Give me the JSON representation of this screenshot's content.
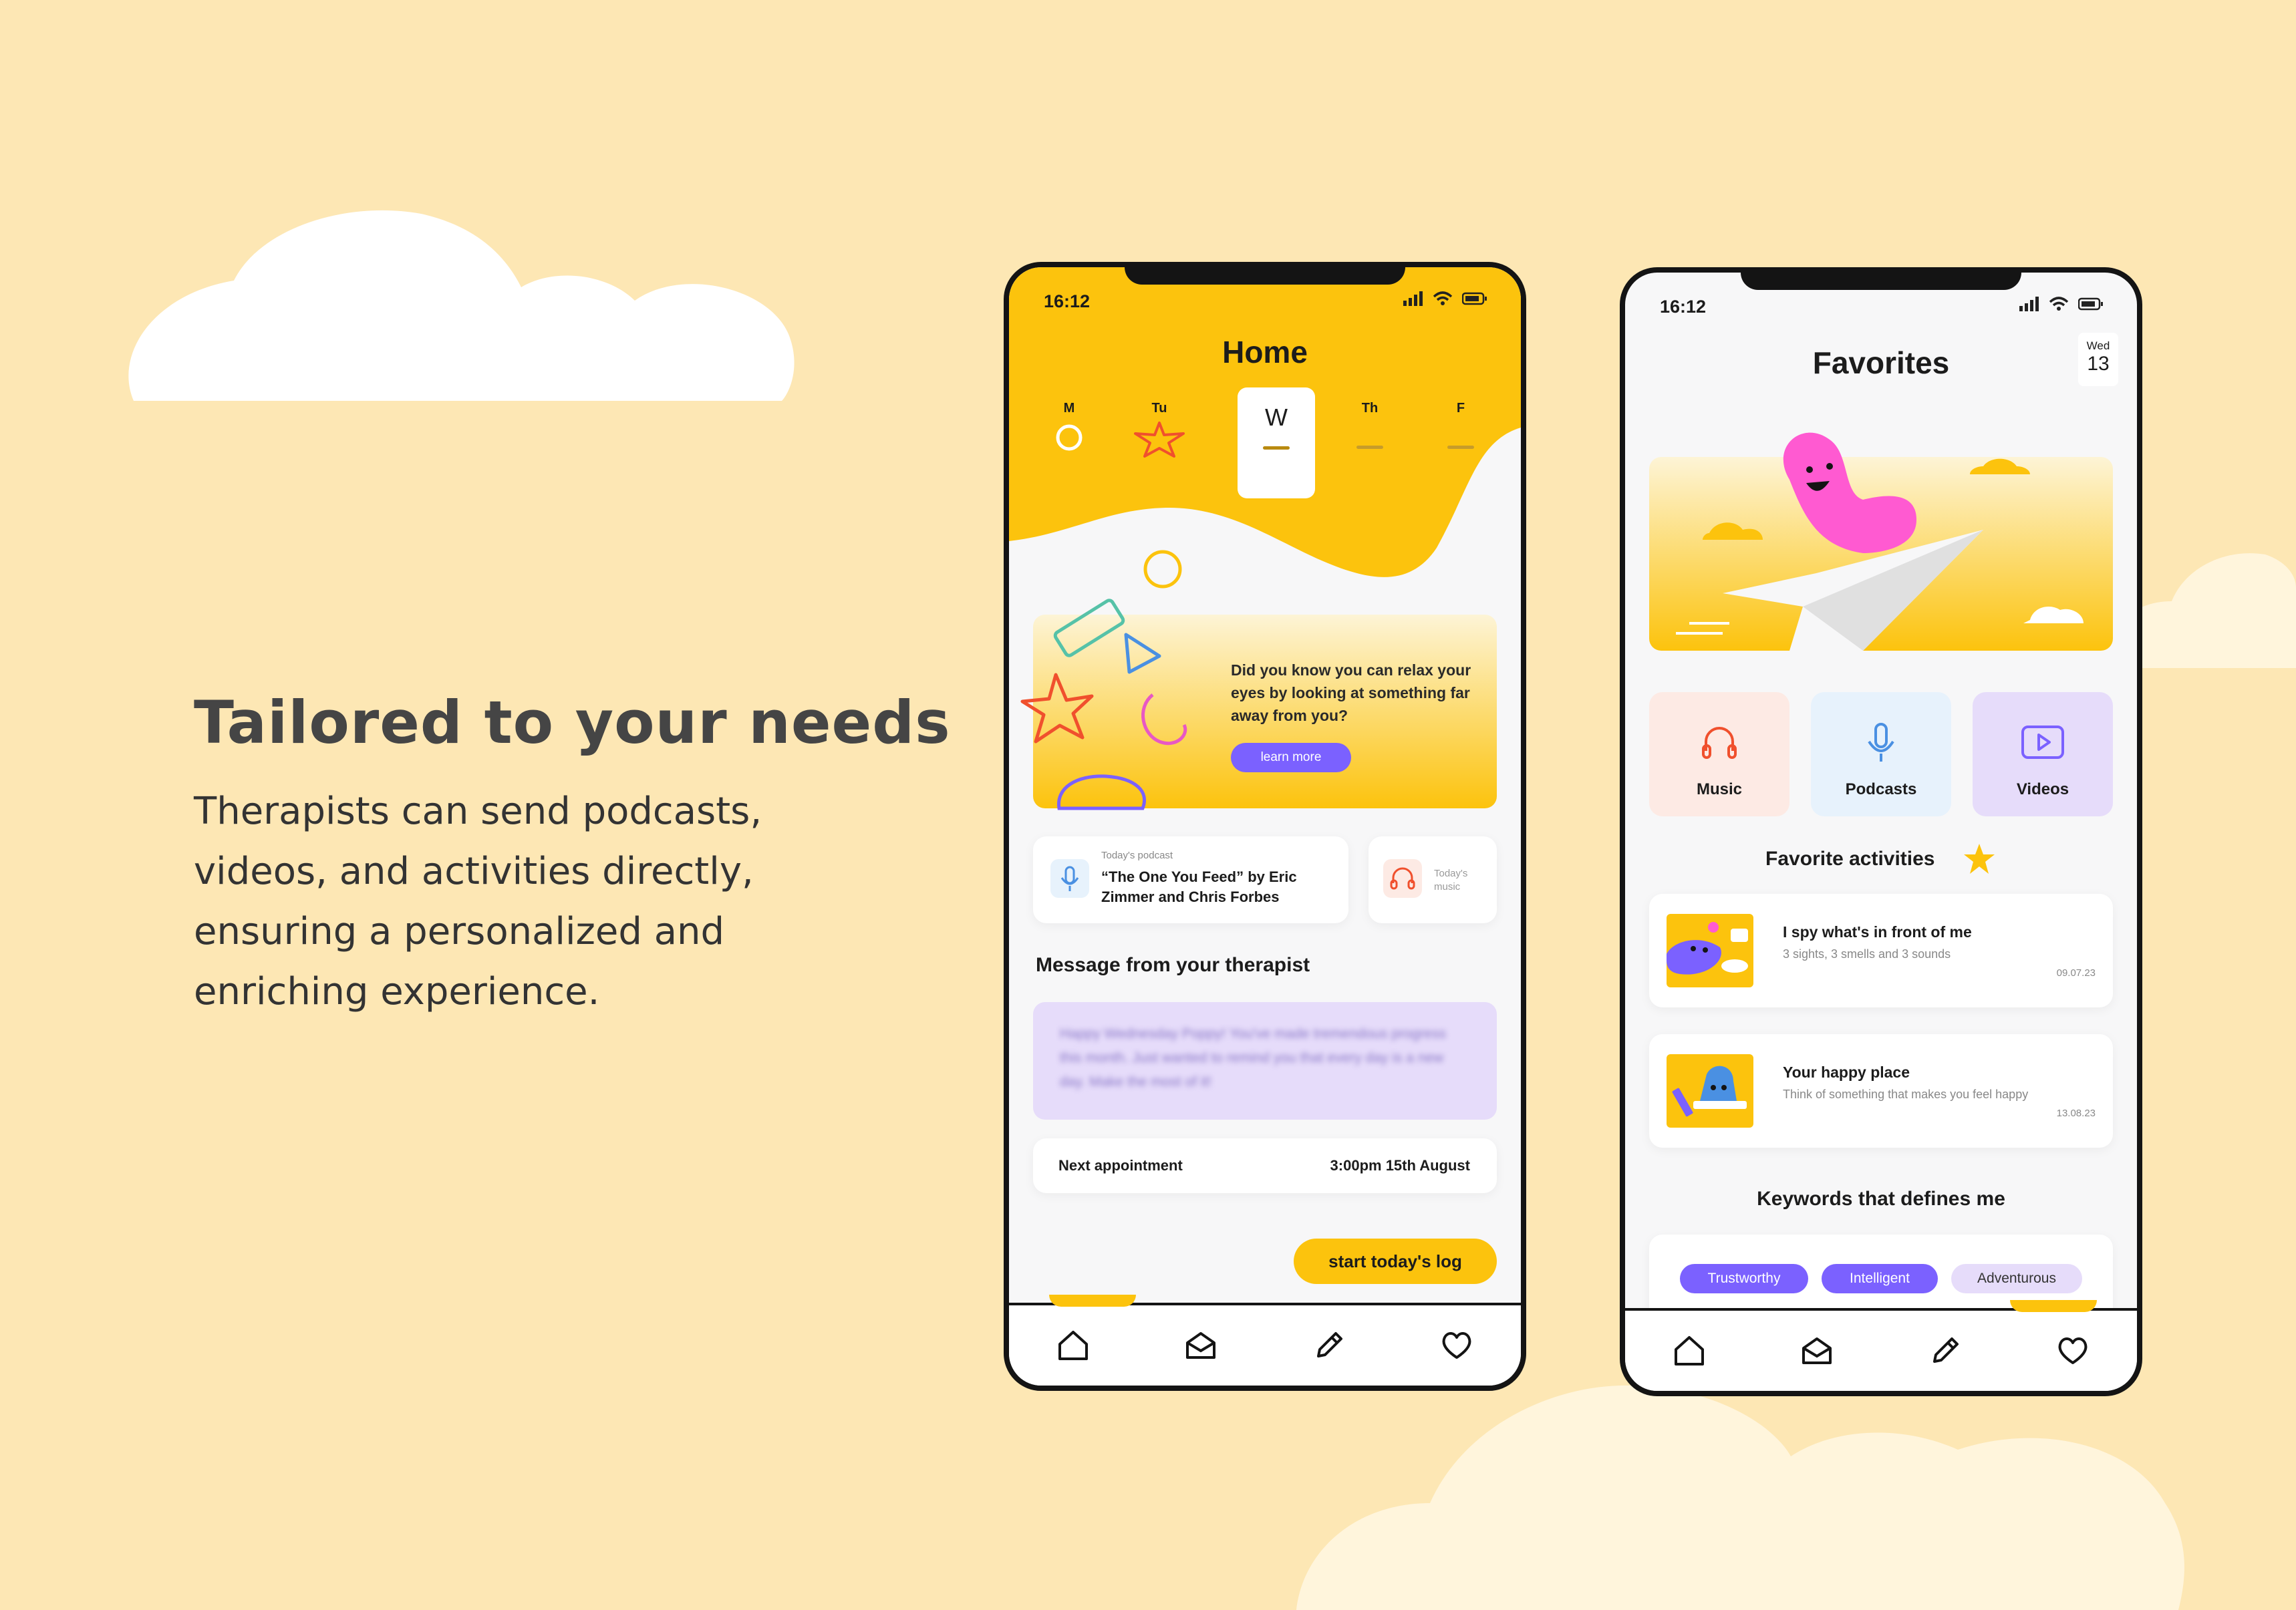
{
  "marketing": {
    "headline": "Tailored to your needs",
    "body": "Therapists can send podcasts, videos, and activities directly, ensuring a personalized and enriching experience."
  },
  "colors": {
    "background": "#fde7b4",
    "accent": "#fcc30d",
    "purple": "#7b61ff",
    "lavender": "#e6dcfa"
  },
  "home": {
    "status_time": "16:12",
    "title": "Home",
    "days": [
      {
        "label": "M",
        "status": "circle"
      },
      {
        "label": "Tu",
        "status": "star"
      },
      {
        "label": "W",
        "status": "selected"
      },
      {
        "label": "Th",
        "status": "dash"
      },
      {
        "label": "F",
        "status": "dash"
      }
    ],
    "tip": {
      "text": "Did you know you can relax your eyes by looking at something far away from you?",
      "button": "learn more"
    },
    "podcast": {
      "caption": "Today's podcast",
      "title": "“The One You Feed” by Eric Zimmer and Chris Forbes"
    },
    "music": {
      "caption": "Today's music"
    },
    "message_heading": "Message from your therapist",
    "message_text": "Happy Wednesday Poppy! You've made tremendous progress this month. Just wanted to remind you that every day is a new day. Make the most of it!",
    "appointment": {
      "label": "Next appointment",
      "value": "3:00pm 15th August"
    },
    "cta": "start today's log"
  },
  "favorites": {
    "status_time": "16:12",
    "title": "Favorites",
    "date": {
      "weekday": "Wed",
      "day": "13"
    },
    "categories": [
      {
        "label": "Music",
        "icon": "headphones-icon"
      },
      {
        "label": "Podcasts",
        "icon": "microphone-icon"
      },
      {
        "label": "Videos",
        "icon": "play-icon"
      }
    ],
    "activities_heading": "Favorite activities",
    "activities": [
      {
        "title": "I spy what's in front of me",
        "subtitle": "3 sights, 3 smells and 3 sounds",
        "date": "09.07.23"
      },
      {
        "title": "Your happy place",
        "subtitle": "Think of something that makes you feel happy",
        "date": "13.08.23"
      }
    ],
    "keywords_heading": "Keywords that defines me",
    "keywords": [
      "Trustworthy",
      "Intelligent",
      "Adventurous"
    ]
  },
  "tabbar_icons": [
    "home-icon",
    "mail-icon",
    "pencil-icon",
    "heart-icon"
  ]
}
